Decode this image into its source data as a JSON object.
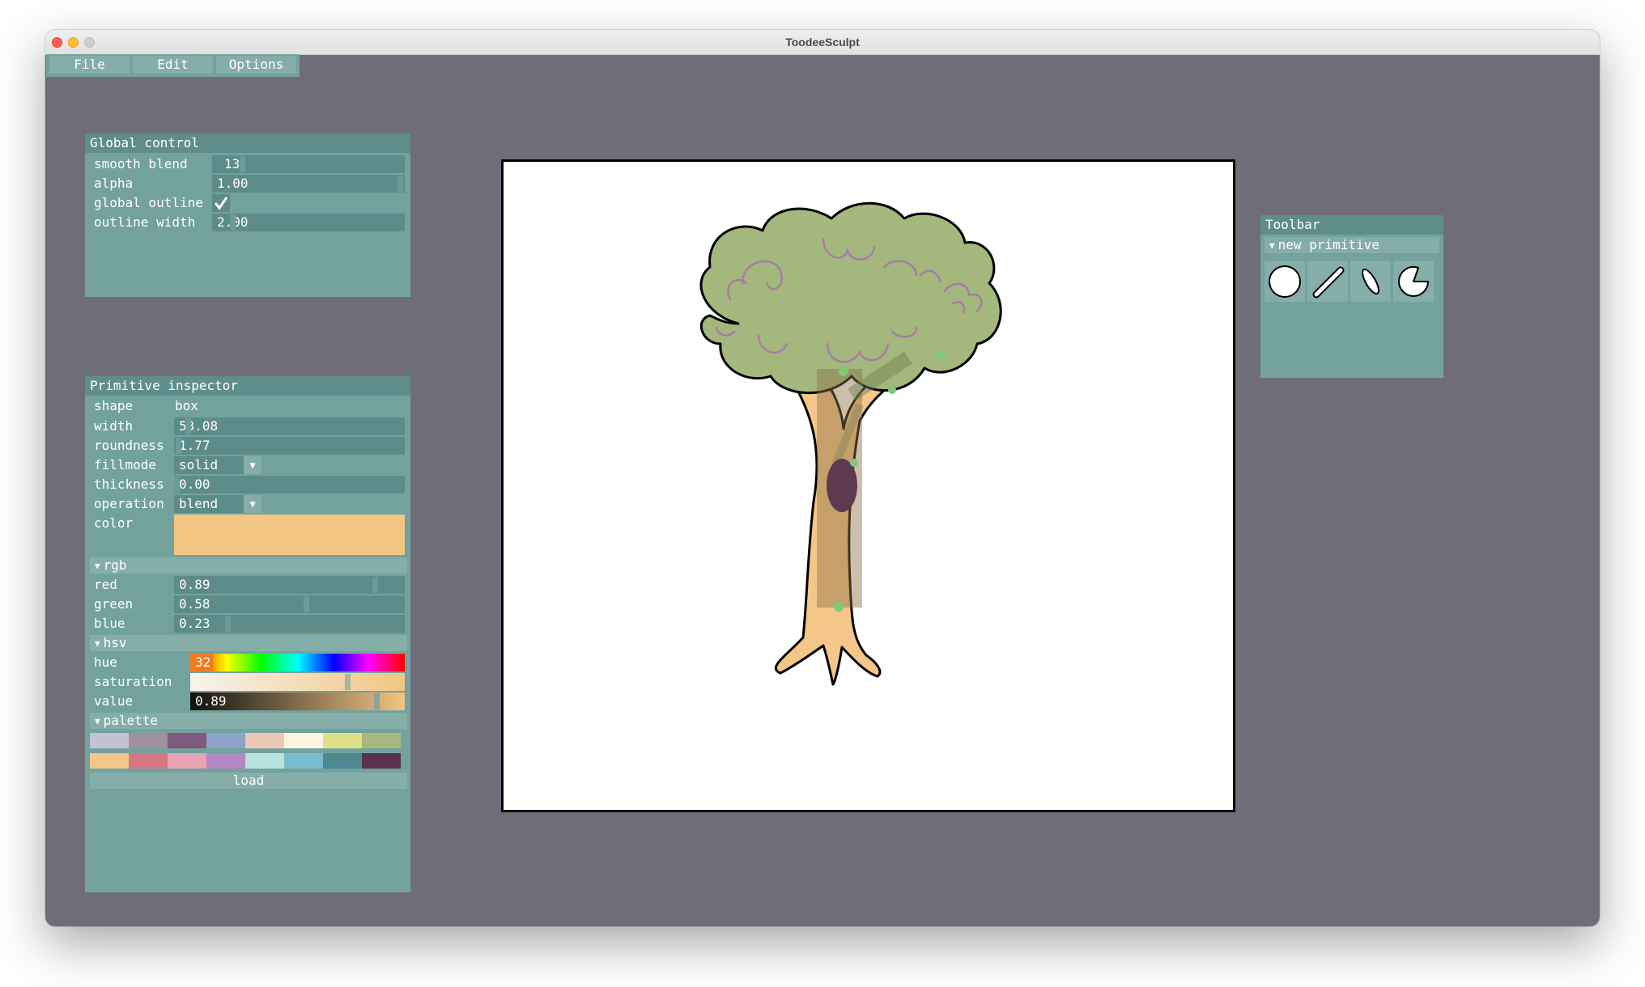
{
  "window": {
    "title": "ToodeeSculpt"
  },
  "menubar": {
    "items": [
      "File",
      "Edit",
      "Options"
    ]
  },
  "global_control": {
    "title": "Global control",
    "smooth_blend": {
      "label": "smooth blend",
      "value": "13"
    },
    "alpha": {
      "label": "alpha",
      "value": "1.00"
    },
    "global_outline": {
      "label": "global outline",
      "checked": true
    },
    "outline_width": {
      "label": "outline width",
      "value": "2.00"
    }
  },
  "inspector": {
    "title": "Primitive inspector",
    "shape": {
      "label": "shape",
      "value": "box"
    },
    "width": {
      "label": "width",
      "value": "53.08"
    },
    "roundness": {
      "label": "roundness",
      "value": "1.77"
    },
    "fillmode": {
      "label": "fillmode",
      "value": "solid"
    },
    "thickness": {
      "label": "thickness",
      "value": "0.00"
    },
    "operation": {
      "label": "operation",
      "value": "blend"
    },
    "color": {
      "label": "color",
      "value": "#f3c683"
    },
    "rgb": {
      "header": "rgb",
      "red": {
        "label": "red",
        "value": "0.89",
        "level": 0.89
      },
      "green": {
        "label": "green",
        "value": "0.58",
        "level": 0.58
      },
      "blue": {
        "label": "blue",
        "value": "0.23",
        "level": 0.23
      }
    },
    "hsv": {
      "header": "hsv",
      "hue": {
        "label": "hue",
        "value": "32"
      },
      "saturation": {
        "label": "saturation",
        "value": "0.75",
        "level": 0.75
      },
      "value": {
        "label": "value",
        "value": "0.89",
        "level": 0.89
      }
    },
    "palette": {
      "header": "palette",
      "colors": [
        "#c3c1d3",
        "#a08ea1",
        "#7e5a7c",
        "#8ea3c9",
        "#ecc9b6",
        "#fcf6e1",
        "#dfe188",
        "#a9b87e",
        "#f4c689",
        "#d47683",
        "#e8a3b2",
        "#b387c2",
        "#b7e4e0",
        "#79bccd",
        "#4d8991",
        "#5b3051"
      ],
      "load_label": "load"
    }
  },
  "toolbar": {
    "title": "Toolbar",
    "section": "new primitive",
    "tools": [
      "circle-tool-icon",
      "line-tool-icon",
      "ellipse-tool-icon",
      "pie-tool-icon"
    ]
  },
  "colors": {
    "window_bg": "#6f6e78",
    "panel_bg": "#73a29e",
    "panel_title_bg": "#5f8d8c",
    "field_bg": "#5d8b89",
    "button_bg": "#85aea9"
  }
}
